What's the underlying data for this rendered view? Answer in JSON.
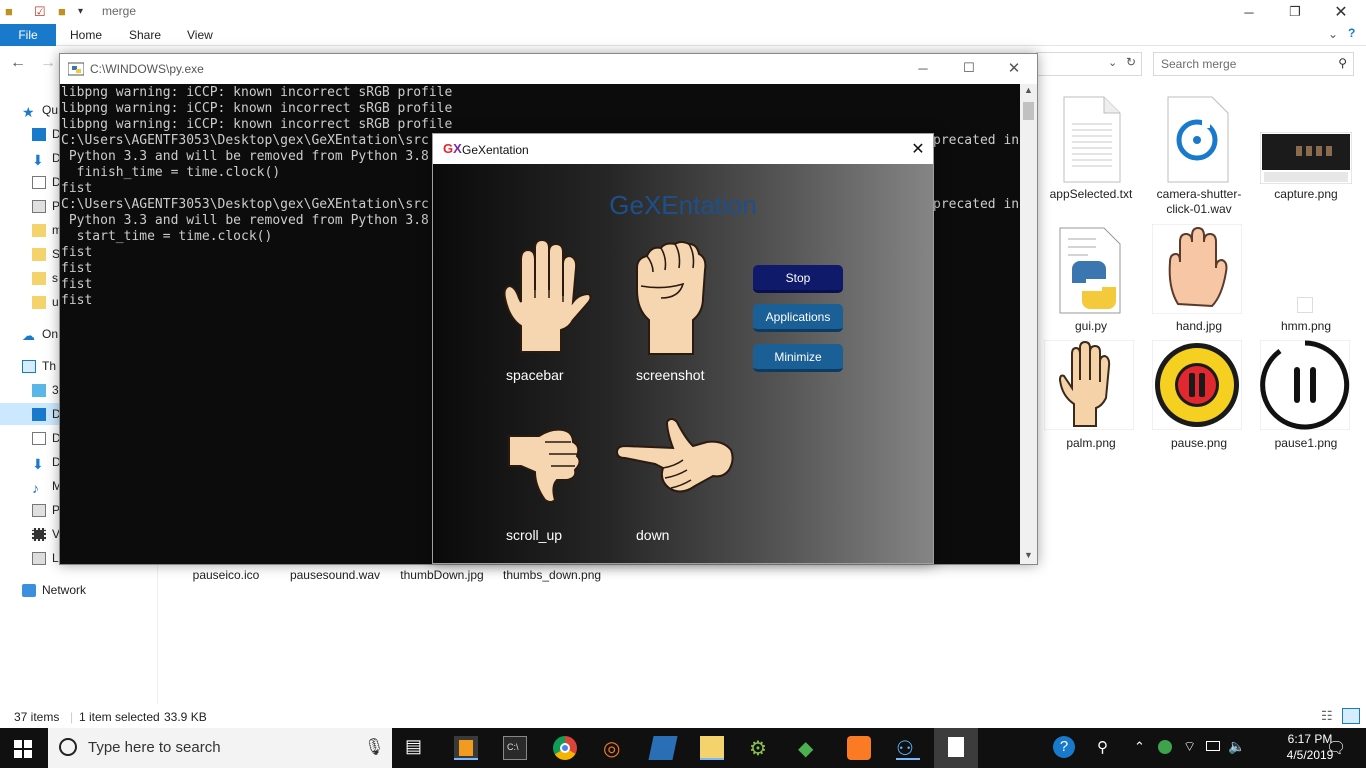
{
  "explorer": {
    "title": "merge",
    "ribbon_tabs": {
      "file": "File",
      "home": "Home",
      "share": "Share",
      "view": "View"
    },
    "search_placeholder": "Search merge",
    "nav": {
      "quick_access": "Qu",
      "items": [
        "D",
        "D",
        "D",
        "P",
        "m",
        "S",
        "s",
        "u"
      ],
      "onedrive": "On",
      "this_pc": "Th",
      "pc_items": [
        "3",
        "D",
        "D",
        "D",
        "M",
        "P",
        "V",
        "L"
      ],
      "network": "Network"
    },
    "files_top": [
      {
        "name": "appSelected.txt",
        "icon": "text-file-icon"
      },
      {
        "name": "camera-shutter-click-01.wav",
        "icon": "audio-file-icon"
      },
      {
        "name": "capture.png",
        "icon": "image-file-icon"
      },
      {
        "name": "gui.py",
        "icon": "python-file-icon"
      },
      {
        "name": "hand.jpg",
        "icon": "hand-image-icon"
      },
      {
        "name": "hmm.png",
        "icon": "blank-image-icon"
      },
      {
        "name": "palm.png",
        "icon": "palm-image-icon"
      },
      {
        "name": "pause.png",
        "icon": "pause-image-icon"
      },
      {
        "name": "pause1.png",
        "icon": "pause1-image-icon"
      }
    ],
    "files_bottom": [
      "pauseico.ico",
      "pausesound.wav",
      "thumbDown.jpg",
      "thumbs_down.png"
    ],
    "status": {
      "count": "37 items",
      "selected": "1 item selected",
      "size": "33.9 KB"
    }
  },
  "console": {
    "title": "C:\\WINDOWS\\py.exe",
    "lines": [
      "libpng warning: iCCP: known incorrect sRGB profile",
      "libpng warning: iCCP: known incorrect sRGB profile",
      "libpng warning: iCCP: known incorrect sRGB profile",
      "C:\\Users\\AGENTF3053\\Desktop\\gex\\GeXEntation\\src",
      " Python 3.3 and will be removed from Python 3.8",
      "  finish_time = time.clock()",
      "fist",
      "C:\\Users\\AGENTF3053\\Desktop\\gex\\GeXEntation\\src",
      " Python 3.3 and will be removed from Python 3.8",
      "  start_time = time.clock()",
      "fist",
      "fist",
      "fist",
      "fist"
    ],
    "right_fragment": "precated in"
  },
  "gex": {
    "title": "GeXentation",
    "heading": "GeXEntation",
    "gestures": {
      "palm": "spacebar",
      "fist": "screenshot",
      "thumb_down": "scroll_up",
      "point": "down"
    },
    "buttons": {
      "stop": "Stop",
      "applications": "Applications",
      "minimize": "Minimize"
    },
    "colors": {
      "stop": "#0f1a6b",
      "applications": "#1a5f95",
      "minimize": "#1a5f95",
      "heading": "#1d4f8c"
    }
  },
  "taskbar": {
    "search_placeholder": "Type here to search",
    "time": "6:17 PM",
    "date": "4/5/2019"
  }
}
